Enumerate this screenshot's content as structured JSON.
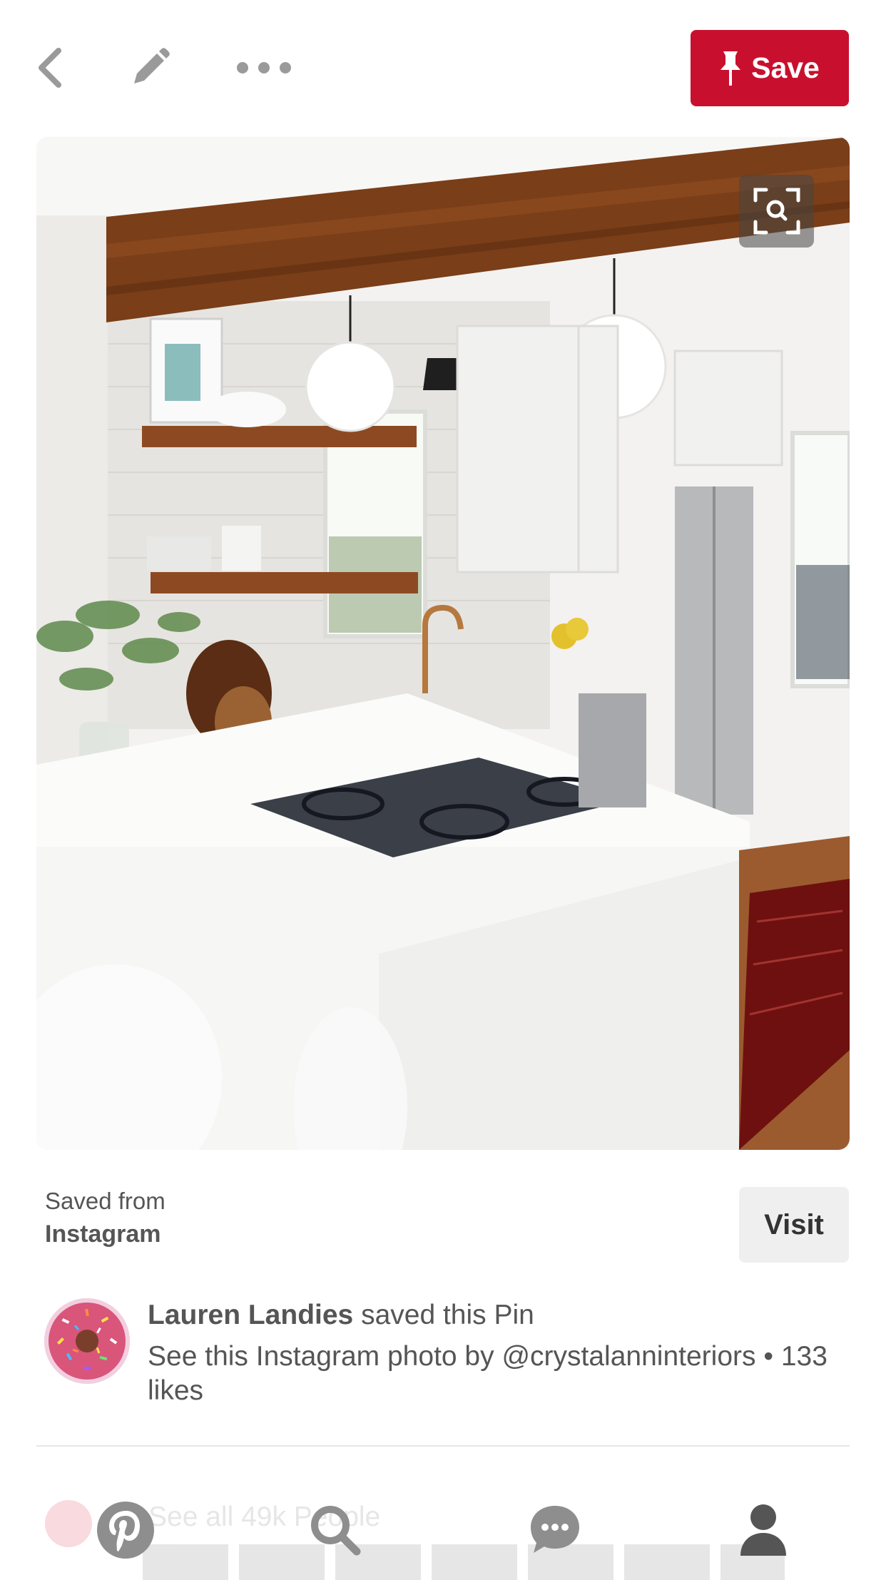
{
  "header": {
    "back_icon": "chevron-left-icon",
    "edit_icon": "pencil-icon",
    "more_icon": "ellipsis-icon",
    "save_label": "Save",
    "save_color": "#c8102e"
  },
  "pin": {
    "image_alt": "Kitchen photo",
    "zoom_icon": "visual-search-icon"
  },
  "source": {
    "saved_from_label": "Saved from",
    "source_name": "Instagram",
    "visit_label": "Visit"
  },
  "saver": {
    "name": "Lauren Landies",
    "action": " saved this Pin",
    "description": "See this Instagram photo by @crystalanninteriors • 133 likes"
  },
  "peek": {
    "text": "See all 49k People"
  },
  "nav": {
    "items": [
      "pinterest-home-icon",
      "search-icon",
      "messages-icon",
      "profile-icon"
    ]
  }
}
